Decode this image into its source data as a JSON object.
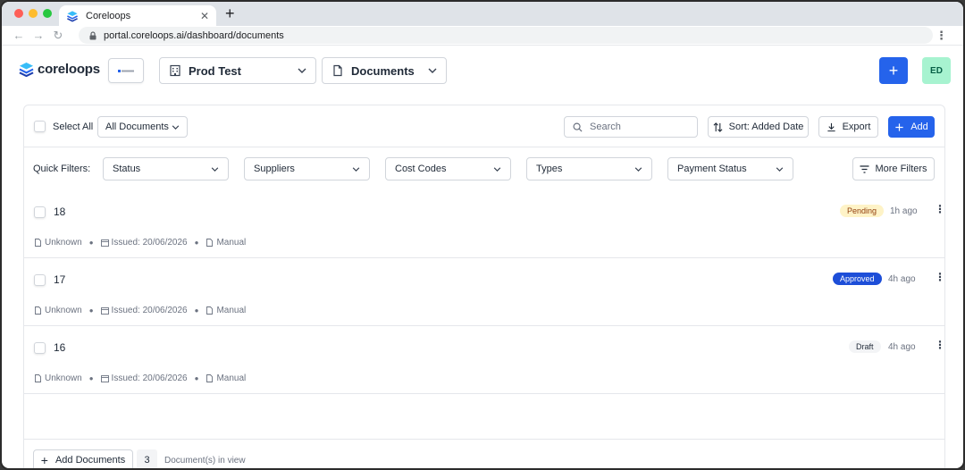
{
  "browser": {
    "tab_title": "Coreloops",
    "url": "portal.coreloops.ai/dashboard/documents"
  },
  "header": {
    "brand": "coreloops",
    "project": "Prod Test",
    "section": "Documents",
    "avatar_initials": "ED",
    "accent_color": "#2563eb",
    "avatar_color": "#a7f3d0"
  },
  "toolbar": {
    "select_all": "Select All",
    "documents_filter": "All Documents",
    "search_placeholder": "Search",
    "sort_label": "Sort: Added Date",
    "export_label": "Export",
    "add_label": "Add"
  },
  "quick_filters": {
    "label": "Quick Filters:",
    "filters": [
      "Status",
      "Suppliers",
      "Cost Codes",
      "Types",
      "Payment Status"
    ],
    "more_label": "More Filters"
  },
  "documents": [
    {
      "number": "18",
      "status": "Pending",
      "time": "1h ago",
      "supplier": "Unknown",
      "issued": "Issued: 20/06/2026",
      "source": "Manual"
    },
    {
      "number": "17",
      "status": "Approved",
      "time": "4h ago",
      "supplier": "Unknown",
      "issued": "Issued: 20/06/2026",
      "source": "Manual"
    },
    {
      "number": "16",
      "status": "Draft",
      "time": "4h ago",
      "supplier": "Unknown",
      "issued": "Issued: 20/06/2026",
      "source": "Manual"
    }
  ],
  "footer": {
    "add_documents": "Add Documents",
    "count": "3",
    "count_label": "Document(s) in view"
  }
}
